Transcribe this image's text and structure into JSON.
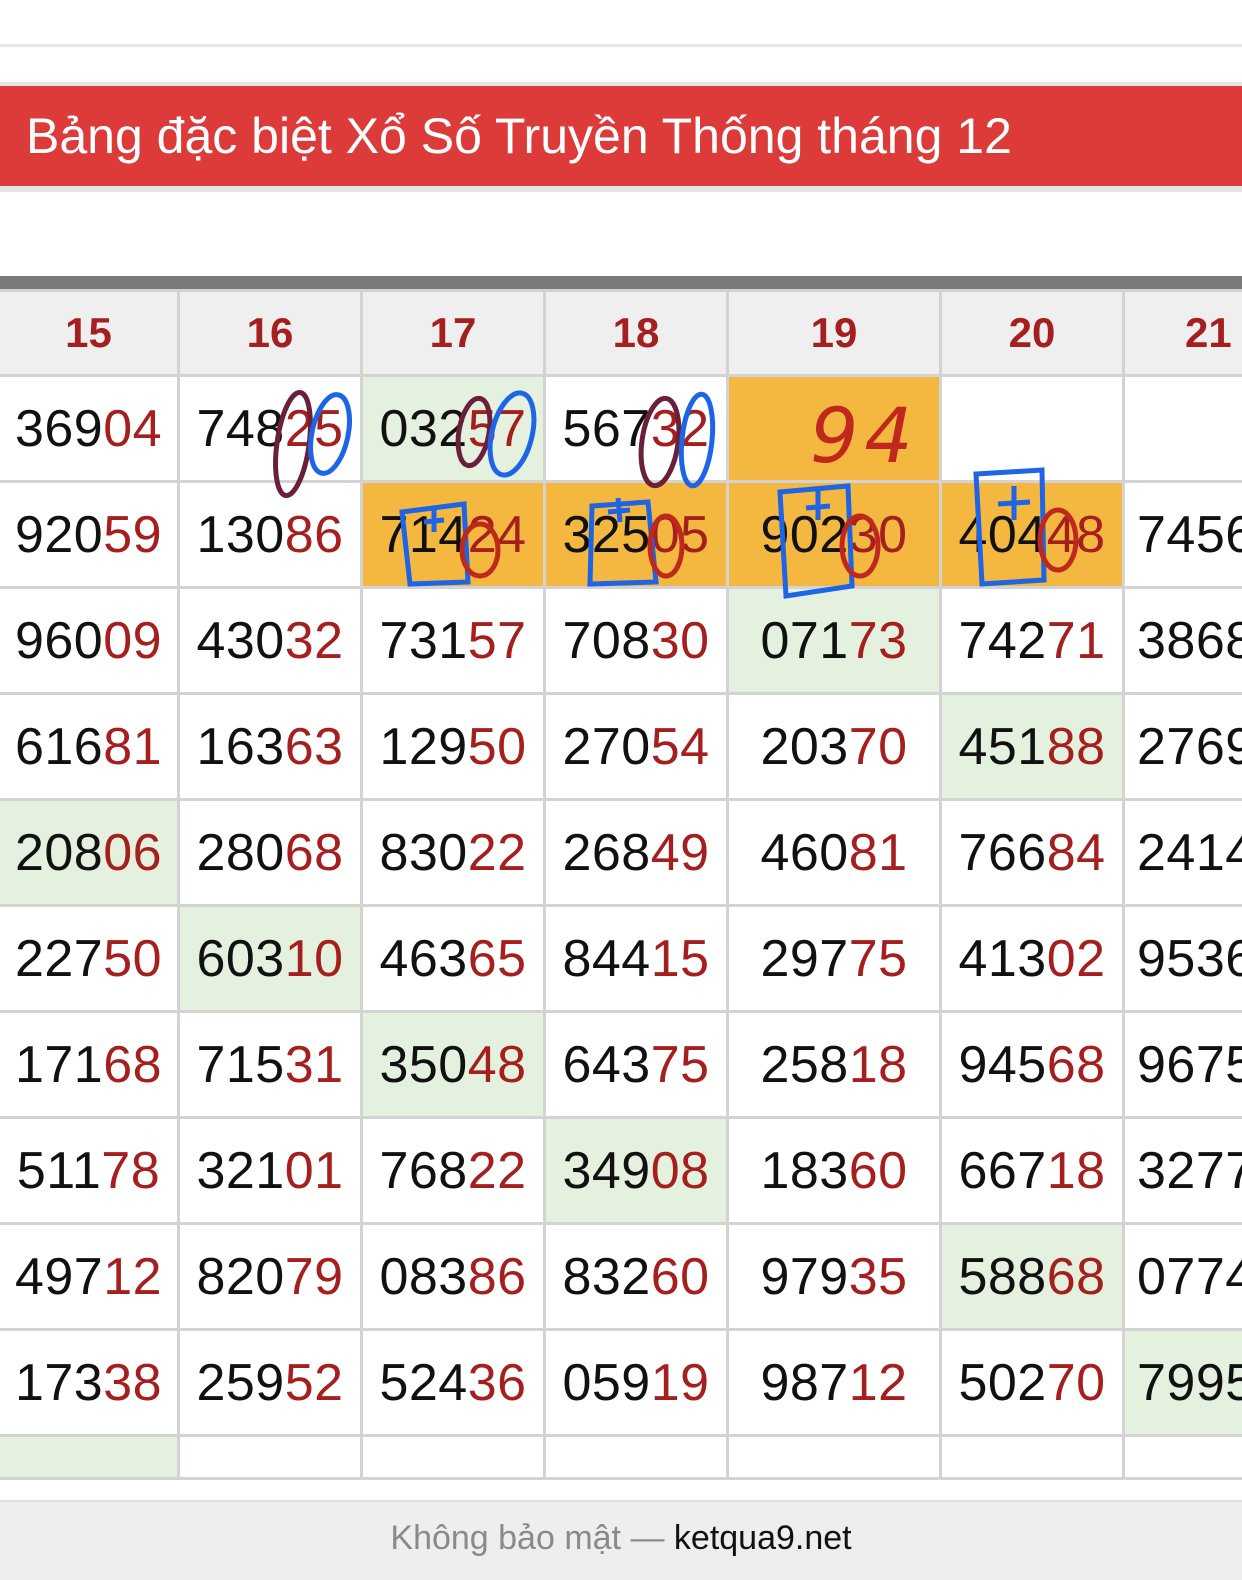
{
  "header": {
    "title": "Bảng đặc biệt Xổ Số Truyền Thống tháng 12"
  },
  "table": {
    "columns": [
      "15",
      "16",
      "17",
      "18",
      "19",
      "20",
      "21"
    ],
    "rows": [
      [
        {
          "pre": "369",
          "suf": "04"
        },
        {
          "pre": "748",
          "suf": "25"
        },
        {
          "pre": "032",
          "suf": "57",
          "hl": "green"
        },
        {
          "pre": "567",
          "suf": "32"
        },
        {
          "pre": "",
          "suf": "",
          "hl": "orange"
        },
        {
          "pre": "",
          "suf": ""
        },
        {
          "pre": "",
          "suf": ""
        }
      ],
      [
        {
          "pre": "920",
          "suf": "59"
        },
        {
          "pre": "130",
          "suf": "86"
        },
        {
          "pre": "714",
          "suf": "24",
          "hl": "orange"
        },
        {
          "pre": "325",
          "suf": "05",
          "hl": "orange"
        },
        {
          "pre": "902",
          "suf": "30",
          "hl": "orange"
        },
        {
          "pre": "404",
          "suf": "48",
          "hl": "orange"
        },
        {
          "pre": "7456",
          "suf": ""
        }
      ],
      [
        {
          "pre": "960",
          "suf": "09"
        },
        {
          "pre": "430",
          "suf": "32"
        },
        {
          "pre": "731",
          "suf": "57"
        },
        {
          "pre": "708",
          "suf": "30"
        },
        {
          "pre": "071",
          "suf": "73",
          "hl": "green"
        },
        {
          "pre": "742",
          "suf": "71"
        },
        {
          "pre": "3868",
          "suf": ""
        }
      ],
      [
        {
          "pre": "616",
          "suf": "81"
        },
        {
          "pre": "163",
          "suf": "63"
        },
        {
          "pre": "129",
          "suf": "50"
        },
        {
          "pre": "270",
          "suf": "54"
        },
        {
          "pre": "203",
          "suf": "70"
        },
        {
          "pre": "451",
          "suf": "88",
          "hl": "green"
        },
        {
          "pre": "2769",
          "suf": ""
        }
      ],
      [
        {
          "pre": "208",
          "suf": "06",
          "hl": "green"
        },
        {
          "pre": "280",
          "suf": "68"
        },
        {
          "pre": "830",
          "suf": "22"
        },
        {
          "pre": "268",
          "suf": "49"
        },
        {
          "pre": "460",
          "suf": "81"
        },
        {
          "pre": "766",
          "suf": "84"
        },
        {
          "pre": "2414",
          "suf": ""
        }
      ],
      [
        {
          "pre": "227",
          "suf": "50"
        },
        {
          "pre": "603",
          "suf": "10",
          "hl": "green"
        },
        {
          "pre": "463",
          "suf": "65"
        },
        {
          "pre": "844",
          "suf": "15"
        },
        {
          "pre": "297",
          "suf": "75"
        },
        {
          "pre": "413",
          "suf": "02"
        },
        {
          "pre": "9536",
          "suf": ""
        }
      ],
      [
        {
          "pre": "171",
          "suf": "68"
        },
        {
          "pre": "715",
          "suf": "31"
        },
        {
          "pre": "350",
          "suf": "48",
          "hl": "green"
        },
        {
          "pre": "643",
          "suf": "75"
        },
        {
          "pre": "258",
          "suf": "18"
        },
        {
          "pre": "945",
          "suf": "68"
        },
        {
          "pre": "9675",
          "suf": ""
        }
      ],
      [
        {
          "pre": "511",
          "suf": "78"
        },
        {
          "pre": "321",
          "suf": "01"
        },
        {
          "pre": "768",
          "suf": "22"
        },
        {
          "pre": "349",
          "suf": "08",
          "hl": "green"
        },
        {
          "pre": "183",
          "suf": "60"
        },
        {
          "pre": "667",
          "suf": "18"
        },
        {
          "pre": "3277",
          "suf": ""
        }
      ],
      [
        {
          "pre": "497",
          "suf": "12"
        },
        {
          "pre": "820",
          "suf": "79"
        },
        {
          "pre": "083",
          "suf": "86"
        },
        {
          "pre": "832",
          "suf": "60"
        },
        {
          "pre": "979",
          "suf": "35"
        },
        {
          "pre": "588",
          "suf": "68",
          "hl": "green"
        },
        {
          "pre": "0774",
          "suf": ""
        }
      ],
      [
        {
          "pre": "173",
          "suf": "38"
        },
        {
          "pre": "259",
          "suf": "52"
        },
        {
          "pre": "524",
          "suf": "36"
        },
        {
          "pre": "059",
          "suf": "19"
        },
        {
          "pre": "987",
          "suf": "12"
        },
        {
          "pre": "502",
          "suf": "70"
        },
        {
          "pre": "7995",
          "suf": "",
          "hl": "green"
        }
      ]
    ]
  },
  "annotations": {
    "handwritten_note": "94"
  },
  "footer": {
    "security": "Không bảo mật —",
    "domain": "ketqua9.net"
  },
  "colors": {
    "banner": "#dd3a3a",
    "highlight_green": "#e4f1de",
    "highlight_orange": "#f4b73f",
    "suffix_red": "#a51f1f",
    "ink_blue": "#1e64e6",
    "ink_red": "#c0281e",
    "ink_purple": "#6a1f3a"
  }
}
